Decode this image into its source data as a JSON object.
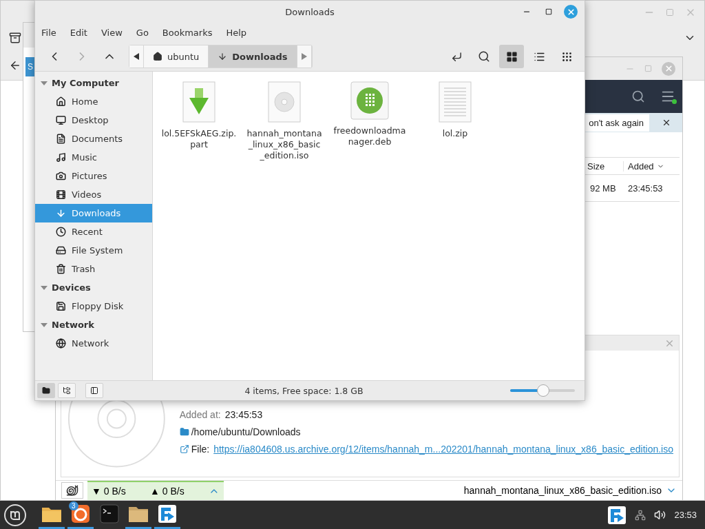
{
  "browser_window": {
    "tab_fragment": "S"
  },
  "download_manager": {
    "notification": {
      "button": "on't ask again"
    },
    "table": {
      "columns": [
        {
          "label": "Size",
          "sorted": false
        },
        {
          "label": "Added",
          "sorted": true
        }
      ],
      "rows": [
        {
          "size": "92 MB",
          "added": "23:45:53"
        }
      ]
    },
    "details": {
      "added_label": "Added at:",
      "added_value": "23:45:53",
      "folder": "/home/ubuntu/Downloads",
      "file_label": "File:",
      "file_url": "https://ia804608.us.archive.org/12/items/hannah_m...202201/hannah_montana_linux_x86_basic_edition.iso"
    },
    "status_bar": {
      "down": "▼ 0 B/s",
      "up": "▲ 0 B/s",
      "file_name": "hannah_montana_linux_x86_basic_edition.iso"
    }
  },
  "file_manager": {
    "title": "Downloads",
    "menu": [
      "File",
      "Edit",
      "View",
      "Go",
      "Bookmarks",
      "Help"
    ],
    "breadcrumbs": [
      {
        "label": "ubuntu",
        "kind": "home",
        "selected": false
      },
      {
        "label": "Downloads",
        "kind": "download",
        "selected": true
      }
    ],
    "view_modes": [
      {
        "kind": "icons",
        "selected": true
      },
      {
        "kind": "list",
        "selected": false
      },
      {
        "kind": "compact",
        "selected": false
      }
    ],
    "sidebar": [
      {
        "title": "My Computer",
        "expanded": true,
        "items": [
          {
            "label": "Home",
            "kind": "home",
            "selected": false
          },
          {
            "label": "Desktop",
            "kind": "desktop",
            "selected": false
          },
          {
            "label": "Documents",
            "kind": "document",
            "selected": false
          },
          {
            "label": "Music",
            "kind": "music",
            "selected": false
          },
          {
            "label": "Pictures",
            "kind": "camera",
            "selected": false
          },
          {
            "label": "Videos",
            "kind": "film",
            "selected": false
          },
          {
            "label": "Downloads",
            "kind": "download",
            "selected": true
          },
          {
            "label": "Recent",
            "kind": "clock",
            "selected": false
          },
          {
            "label": "File System",
            "kind": "drive",
            "selected": false
          },
          {
            "label": "Trash",
            "kind": "trash",
            "selected": false
          }
        ]
      },
      {
        "title": "Devices",
        "expanded": true,
        "items": [
          {
            "label": "Floppy Disk",
            "kind": "floppy",
            "selected": false
          }
        ]
      },
      {
        "title": "Network",
        "expanded": true,
        "items": [
          {
            "label": "Network",
            "kind": "globe",
            "selected": false
          }
        ]
      }
    ],
    "files": [
      {
        "name": "lol.5EFSkAEG.zip.part",
        "kind": "partial"
      },
      {
        "name": "hannah_montana_linux_x86_basic_edition.iso",
        "kind": "disc"
      },
      {
        "name": "freedownloadmanager.deb",
        "kind": "package"
      },
      {
        "name": "lol.zip",
        "kind": "text"
      }
    ],
    "pane_buttons": [
      {
        "kind": "places",
        "selected": true
      },
      {
        "kind": "tree",
        "selected": false
      },
      {
        "kind": "sidebar",
        "selected": false
      }
    ],
    "status": "4 items, Free space: 1.8 GB",
    "zoom": {
      "level": 0.5
    }
  },
  "taskbar": {
    "apps": [
      {
        "kind": "files",
        "running": true
      },
      {
        "kind": "browser",
        "badge": "3",
        "running": true
      },
      {
        "kind": "terminal",
        "running": false
      },
      {
        "kind": "folder",
        "running": true
      },
      {
        "kind": "downloader",
        "running": true
      }
    ],
    "clock": "23:53"
  }
}
